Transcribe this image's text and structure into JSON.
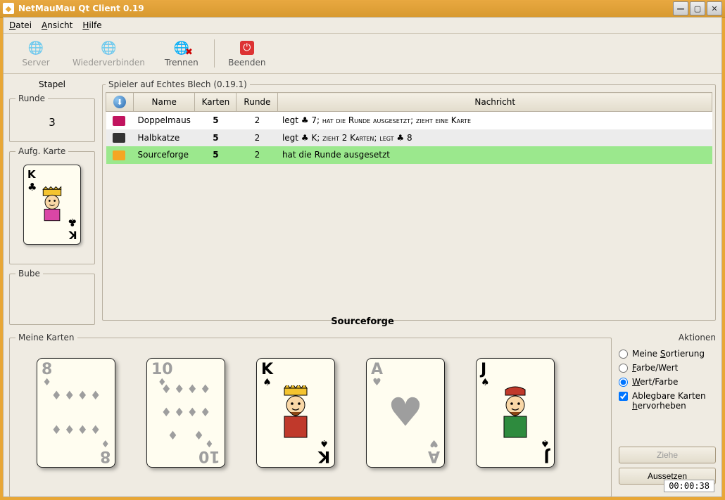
{
  "window": {
    "title": "NetMauMau Qt Client 0.19"
  },
  "menu": {
    "datei": "Datei",
    "ansicht": "Ansicht",
    "hilfe": "Hilfe"
  },
  "toolbar": {
    "server": "Server",
    "wiederverbinden": "Wiederverbinden",
    "trennen": "Trennen",
    "beenden": "Beenden"
  },
  "stapel": {
    "title": "Stapel",
    "runde_label": "Runde",
    "runde_value": "3",
    "aufg_label": "Aufg. Karte",
    "bube_label": "Bube",
    "card": {
      "rank": "K",
      "suit": "♣"
    }
  },
  "spieler": {
    "title": "Spieler auf Echtes Blech (0.19.1)",
    "headers": {
      "name": "Name",
      "karten": "Karten",
      "runde": "Runde",
      "nachricht": "Nachricht"
    },
    "rows": [
      {
        "name": "Doppelmaus",
        "karten": "5",
        "runde": "2",
        "nachricht_html": "legt ♣ 7; <span class='sc'>hat die Runde ausgesetzt; zieht eine Karte</span>"
      },
      {
        "name": "Halbkatze",
        "karten": "5",
        "runde": "2",
        "nachricht_html": "legt ♣ K; <span class='sc'>zieht 2 Karten; legt</span> ♣ 8"
      },
      {
        "name": "Sourceforge",
        "karten": "5",
        "runde": "2",
        "nachricht_html": "hat die Runde ausgesetzt"
      }
    ]
  },
  "current_player": "Sourceforge",
  "hand": {
    "title": "Meine Karten",
    "cards": [
      {
        "rank": "8",
        "suit": "♦",
        "playable": false
      },
      {
        "rank": "10",
        "suit": "♦",
        "playable": false
      },
      {
        "rank": "K",
        "suit": "♠",
        "playable": true,
        "face": true
      },
      {
        "rank": "A",
        "suit": "♥",
        "playable": false
      },
      {
        "rank": "J",
        "suit": "♠",
        "playable": true,
        "face": true
      }
    ]
  },
  "aktionen": {
    "title": "Aktionen",
    "sort_meine": "Meine Sortierung",
    "sort_farbe_wert": "Farbe/Wert",
    "sort_wert_farbe": "Wert/Farbe",
    "highlight": "Ablegbare Karten hervorheben",
    "ziehe": "Ziehe",
    "aussetzen": "Aussetzen"
  },
  "status": {
    "clock": "00:00:38"
  }
}
